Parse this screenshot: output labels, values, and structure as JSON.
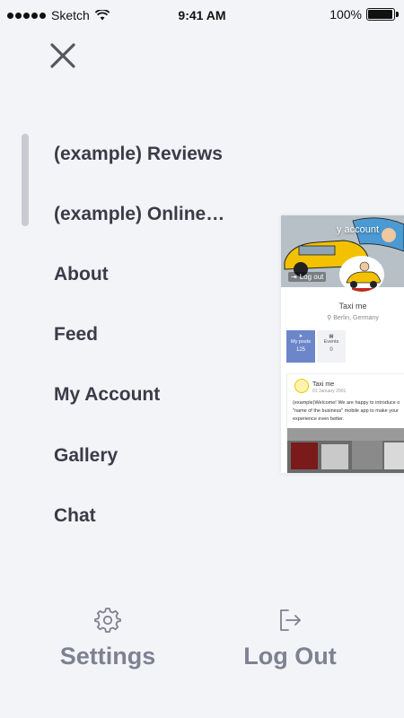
{
  "status_bar": {
    "carrier": "Sketch",
    "time": "9:41 AM",
    "battery_percent": "100%",
    "battery_level": 1.0
  },
  "menu": {
    "items": [
      {
        "label": "(example) Reviews"
      },
      {
        "label": "(example) Online…"
      },
      {
        "label": "About"
      },
      {
        "label": "Feed"
      },
      {
        "label": "My Account"
      },
      {
        "label": "Gallery"
      },
      {
        "label": "Chat"
      }
    ]
  },
  "preview": {
    "cover_title": "y account",
    "logout_label": "Log out",
    "business_name": "Taxi me",
    "location": "Berlin, Germany",
    "stats": [
      {
        "label": "My posts",
        "value": "125"
      },
      {
        "label": "Events",
        "value": "0"
      }
    ],
    "post": {
      "author": "Taxi me",
      "date": "01 January 2001",
      "text": "(example)Welcome! We are happy to introduce o \"name of the business\" mobile app to make your experience even better."
    }
  },
  "bottom": {
    "settings_label": "Settings",
    "logout_label": "Log Out"
  },
  "colors": {
    "background": "#f3f4f8",
    "menu_text": "#3b3c48",
    "bottom_text": "#7e8191",
    "accent": "#6c86c9"
  },
  "icons": {
    "close": "close-icon",
    "settings": "gear-icon",
    "logout": "logout-icon"
  }
}
